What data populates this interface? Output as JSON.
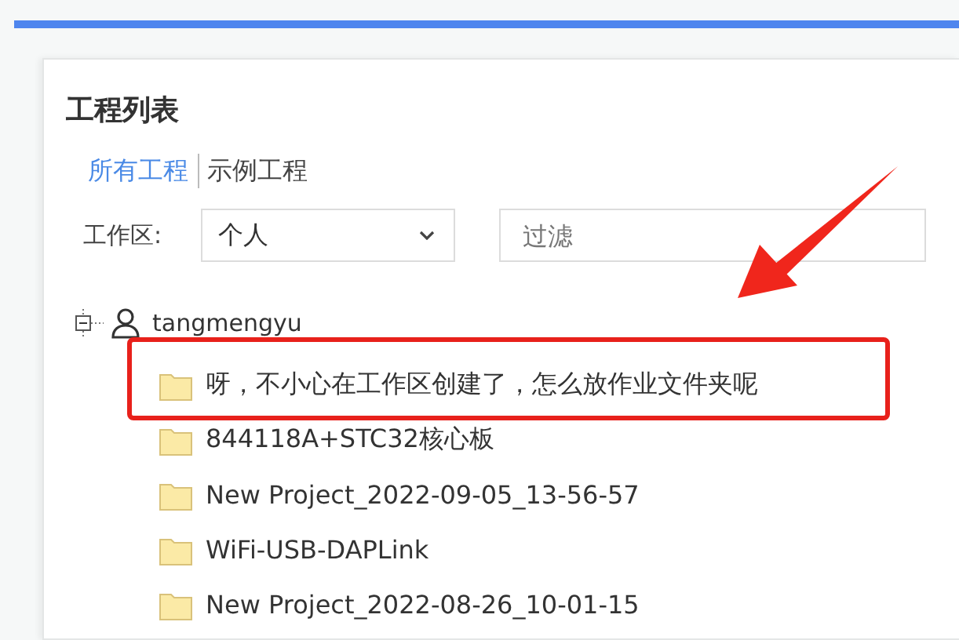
{
  "panel": {
    "title": "工程列表"
  },
  "tabs": [
    {
      "label": "所有工程",
      "selected": true
    },
    {
      "label": "示例工程",
      "selected": false
    }
  ],
  "workspace": {
    "label": "工作区:",
    "value": "个人"
  },
  "filter": {
    "placeholder": "过滤"
  },
  "tree": {
    "label": "tangmengyu",
    "expanded": true,
    "children": [
      {
        "label": "呀，不小心在工作区创建了，怎么放作业文件夹呢"
      },
      {
        "label": "844118A+STC32核心板"
      },
      {
        "label": "New Project_2022-09-05_13-56-57"
      },
      {
        "label": "WiFi-USB-DAPLink"
      },
      {
        "label": "New Project_2022-08-26_10-01-15"
      }
    ]
  }
}
